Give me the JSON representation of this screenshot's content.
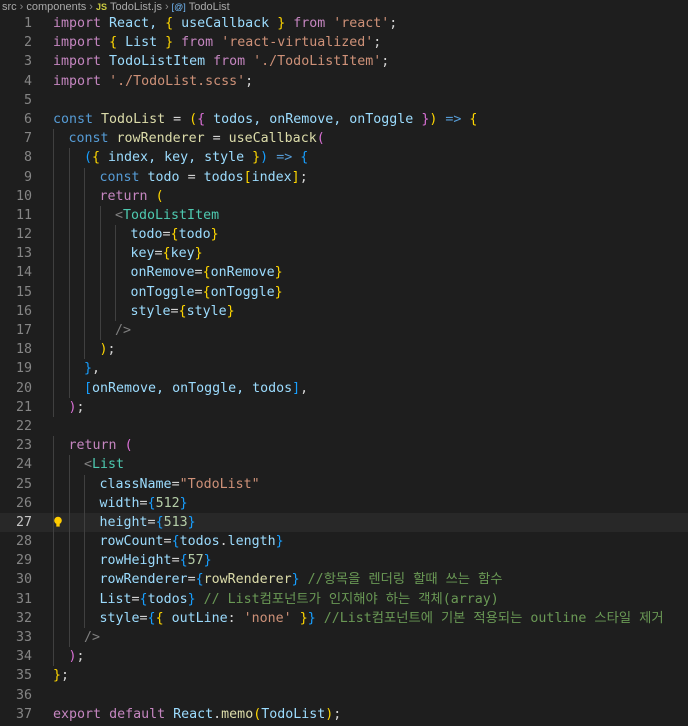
{
  "breadcrumb": {
    "items": [
      "src",
      "components",
      "TodoList.js",
      "TodoList"
    ],
    "js_badge": "JS",
    "symbol_badge": "[@]"
  },
  "editor": {
    "current_line": 27,
    "lightbulb_line": 27,
    "lines": [
      {
        "n": "1",
        "indent": 0,
        "tokens": [
          [
            "import",
            "ctl"
          ],
          [
            " React, ",
            "var"
          ],
          [
            "{",
            "br1"
          ],
          [
            " useCallback ",
            "var"
          ],
          [
            "}",
            "br1"
          ],
          [
            " from ",
            "ctl"
          ],
          [
            "'react'",
            "str"
          ],
          [
            ";",
            "plain"
          ]
        ]
      },
      {
        "n": "2",
        "indent": 0,
        "tokens": [
          [
            "import",
            "ctl"
          ],
          [
            " ",
            "plain"
          ],
          [
            "{",
            "br1"
          ],
          [
            " List ",
            "var"
          ],
          [
            "}",
            "br1"
          ],
          [
            " from ",
            "ctl"
          ],
          [
            "'react-virtualized'",
            "str"
          ],
          [
            ";",
            "plain"
          ]
        ]
      },
      {
        "n": "3",
        "indent": 0,
        "tokens": [
          [
            "import",
            "ctl"
          ],
          [
            " TodoListItem ",
            "var"
          ],
          [
            "from ",
            "ctl"
          ],
          [
            "'./TodoListItem'",
            "str"
          ],
          [
            ";",
            "plain"
          ]
        ]
      },
      {
        "n": "4",
        "indent": 0,
        "tokens": [
          [
            "import",
            "ctl"
          ],
          [
            " ",
            "plain"
          ],
          [
            "'./TodoList.scss'",
            "str"
          ],
          [
            ";",
            "plain"
          ]
        ]
      },
      {
        "n": "5",
        "indent": 0,
        "tokens": []
      },
      {
        "n": "6",
        "indent": 0,
        "tokens": [
          [
            "const",
            "kw"
          ],
          [
            " ",
            "plain"
          ],
          [
            "TodoList",
            "fn"
          ],
          [
            " = ",
            "plain"
          ],
          [
            "(",
            "br1"
          ],
          [
            "{",
            "br2"
          ],
          [
            " todos, onRemove, onToggle ",
            "var"
          ],
          [
            "}",
            "br2"
          ],
          [
            ")",
            "br1"
          ],
          [
            " ",
            "plain"
          ],
          [
            "=>",
            "kw"
          ],
          [
            " ",
            "plain"
          ],
          [
            "{",
            "br1"
          ]
        ]
      },
      {
        "n": "7",
        "indent": 1,
        "tokens": [
          [
            "const",
            "kw"
          ],
          [
            " ",
            "plain"
          ],
          [
            "rowRenderer",
            "fn"
          ],
          [
            " = ",
            "plain"
          ],
          [
            "useCallback",
            "fn"
          ],
          [
            "(",
            "br2"
          ]
        ]
      },
      {
        "n": "8",
        "indent": 2,
        "tokens": [
          [
            "(",
            "br3"
          ],
          [
            "{",
            "br1"
          ],
          [
            " index, key, style ",
            "var"
          ],
          [
            "}",
            "br1"
          ],
          [
            ")",
            "br3"
          ],
          [
            " ",
            "plain"
          ],
          [
            "=>",
            "kw"
          ],
          [
            " ",
            "plain"
          ],
          [
            "{",
            "br3"
          ]
        ]
      },
      {
        "n": "9",
        "indent": 3,
        "tokens": [
          [
            "const",
            "kw"
          ],
          [
            " todo",
            "var"
          ],
          [
            " = ",
            "plain"
          ],
          [
            "todos",
            "var"
          ],
          [
            "[",
            "br1"
          ],
          [
            "index",
            "var"
          ],
          [
            "]",
            "br1"
          ],
          [
            ";",
            "plain"
          ]
        ]
      },
      {
        "n": "10",
        "indent": 3,
        "tokens": [
          [
            "return",
            "ctl"
          ],
          [
            " ",
            "plain"
          ],
          [
            "(",
            "br1"
          ]
        ]
      },
      {
        "n": "11",
        "indent": 4,
        "tokens": [
          [
            "<",
            "tag"
          ],
          [
            "TodoListItem",
            "cls"
          ]
        ]
      },
      {
        "n": "12",
        "indent": 5,
        "tokens": [
          [
            "todo",
            "attr"
          ],
          [
            "=",
            "plain"
          ],
          [
            "{",
            "br1"
          ],
          [
            "todo",
            "var"
          ],
          [
            "}",
            "br1"
          ]
        ]
      },
      {
        "n": "13",
        "indent": 5,
        "tokens": [
          [
            "key",
            "attr"
          ],
          [
            "=",
            "plain"
          ],
          [
            "{",
            "br1"
          ],
          [
            "key",
            "var"
          ],
          [
            "}",
            "br1"
          ]
        ]
      },
      {
        "n": "14",
        "indent": 5,
        "tokens": [
          [
            "onRemove",
            "attr"
          ],
          [
            "=",
            "plain"
          ],
          [
            "{",
            "br1"
          ],
          [
            "onRemove",
            "var"
          ],
          [
            "}",
            "br1"
          ]
        ]
      },
      {
        "n": "15",
        "indent": 5,
        "tokens": [
          [
            "onToggle",
            "attr"
          ],
          [
            "=",
            "plain"
          ],
          [
            "{",
            "br1"
          ],
          [
            "onToggle",
            "var"
          ],
          [
            "}",
            "br1"
          ]
        ]
      },
      {
        "n": "16",
        "indent": 5,
        "tokens": [
          [
            "style",
            "attr"
          ],
          [
            "=",
            "plain"
          ],
          [
            "{",
            "br1"
          ],
          [
            "style",
            "var"
          ],
          [
            "}",
            "br1"
          ]
        ]
      },
      {
        "n": "17",
        "indent": 4,
        "tokens": [
          [
            "/>",
            "tag"
          ]
        ]
      },
      {
        "n": "18",
        "indent": 3,
        "tokens": [
          [
            ")",
            "br1"
          ],
          [
            ";",
            "plain"
          ]
        ]
      },
      {
        "n": "19",
        "indent": 2,
        "tokens": [
          [
            "}",
            "br3"
          ],
          [
            ",",
            "plain"
          ]
        ]
      },
      {
        "n": "20",
        "indent": 2,
        "tokens": [
          [
            "[",
            "br3"
          ],
          [
            "onRemove, onToggle, todos",
            "var"
          ],
          [
            "]",
            "br3"
          ],
          [
            ",",
            "plain"
          ]
        ]
      },
      {
        "n": "21",
        "indent": 1,
        "tokens": [
          [
            ")",
            "br2"
          ],
          [
            ";",
            "plain"
          ]
        ]
      },
      {
        "n": "22",
        "indent": 0,
        "tokens": []
      },
      {
        "n": "23",
        "indent": 1,
        "tokens": [
          [
            "return",
            "ctl"
          ],
          [
            " ",
            "plain"
          ],
          [
            "(",
            "br2"
          ]
        ]
      },
      {
        "n": "24",
        "indent": 2,
        "tokens": [
          [
            "<",
            "tag"
          ],
          [
            "List",
            "cls"
          ]
        ]
      },
      {
        "n": "25",
        "indent": 3,
        "tokens": [
          [
            "className",
            "attr"
          ],
          [
            "=",
            "plain"
          ],
          [
            "\"TodoList\"",
            "str"
          ]
        ]
      },
      {
        "n": "26",
        "indent": 3,
        "tokens": [
          [
            "width",
            "attr"
          ],
          [
            "=",
            "plain"
          ],
          [
            "{",
            "br3"
          ],
          [
            "512",
            "num"
          ],
          [
            "}",
            "br3"
          ]
        ]
      },
      {
        "n": "27",
        "indent": 3,
        "tokens": [
          [
            "height",
            "attr"
          ],
          [
            "=",
            "plain"
          ],
          [
            "{",
            "br3"
          ],
          [
            "513",
            "num"
          ],
          [
            "}",
            "br3"
          ]
        ]
      },
      {
        "n": "28",
        "indent": 3,
        "tokens": [
          [
            "rowCount",
            "attr"
          ],
          [
            "=",
            "plain"
          ],
          [
            "{",
            "br3"
          ],
          [
            "todos",
            "var"
          ],
          [
            ".",
            "plain"
          ],
          [
            "length",
            "var"
          ],
          [
            "}",
            "br3"
          ]
        ]
      },
      {
        "n": "29",
        "indent": 3,
        "tokens": [
          [
            "rowHeight",
            "attr"
          ],
          [
            "=",
            "plain"
          ],
          [
            "{",
            "br3"
          ],
          [
            "57",
            "num"
          ],
          [
            "}",
            "br3"
          ]
        ]
      },
      {
        "n": "30",
        "indent": 3,
        "tokens": [
          [
            "rowRenderer",
            "attr"
          ],
          [
            "=",
            "plain"
          ],
          [
            "{",
            "br3"
          ],
          [
            "rowRenderer",
            "fn"
          ],
          [
            "}",
            "br3"
          ],
          [
            " //항목을 렌더링 할때 쓰는 함수",
            "cmt"
          ]
        ]
      },
      {
        "n": "31",
        "indent": 3,
        "tokens": [
          [
            "List",
            "attr"
          ],
          [
            "=",
            "plain"
          ],
          [
            "{",
            "br3"
          ],
          [
            "todos",
            "var"
          ],
          [
            "}",
            "br3"
          ],
          [
            " // List컴포넌트가 인지해야 하는 객체(array)",
            "cmt"
          ]
        ]
      },
      {
        "n": "32",
        "indent": 3,
        "tokens": [
          [
            "style",
            "attr"
          ],
          [
            "=",
            "plain"
          ],
          [
            "{",
            "br3"
          ],
          [
            "{",
            "br1"
          ],
          [
            " outLine",
            "var"
          ],
          [
            ": ",
            "plain"
          ],
          [
            "'none'",
            "str"
          ],
          [
            " ",
            "plain"
          ],
          [
            "}",
            "br1"
          ],
          [
            "}",
            "br3"
          ],
          [
            " //List컴포넌트에 기본 적용되는 outline 스타일 제거",
            "cmt"
          ]
        ]
      },
      {
        "n": "33",
        "indent": 2,
        "tokens": [
          [
            "/>",
            "tag"
          ]
        ]
      },
      {
        "n": "34",
        "indent": 1,
        "tokens": [
          [
            ")",
            "br2"
          ],
          [
            ";",
            "plain"
          ]
        ]
      },
      {
        "n": "35",
        "indent": 0,
        "tokens": [
          [
            "}",
            "br1"
          ],
          [
            ";",
            "plain"
          ]
        ]
      },
      {
        "n": "36",
        "indent": 0,
        "tokens": []
      },
      {
        "n": "37",
        "indent": 0,
        "tokens": [
          [
            "export",
            "ctl"
          ],
          [
            " ",
            "plain"
          ],
          [
            "default",
            "ctl"
          ],
          [
            " ",
            "plain"
          ],
          [
            "React",
            "var"
          ],
          [
            ".",
            "plain"
          ],
          [
            "memo",
            "fn"
          ],
          [
            "(",
            "br1"
          ],
          [
            "TodoList",
            "var"
          ],
          [
            ")",
            "br1"
          ],
          [
            ";",
            "plain"
          ]
        ]
      }
    ]
  }
}
